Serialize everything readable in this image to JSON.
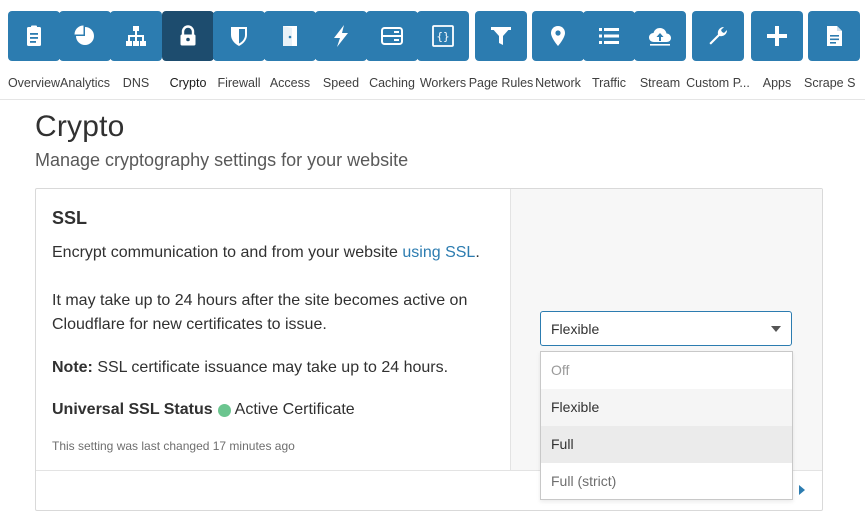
{
  "nav": {
    "items": [
      {
        "label": "Overview",
        "icon": "clipboard-icon"
      },
      {
        "label": "Analytics",
        "icon": "pie-chart-icon"
      },
      {
        "label": "DNS",
        "icon": "network-tree-icon"
      },
      {
        "label": "Crypto",
        "icon": "lock-icon",
        "active": true
      },
      {
        "label": "Firewall",
        "icon": "shield-icon"
      },
      {
        "label": "Access",
        "icon": "door-icon"
      },
      {
        "label": "Speed",
        "icon": "lightning-icon"
      },
      {
        "label": "Caching",
        "icon": "server-icon"
      },
      {
        "label": "Workers",
        "icon": "code-braces-icon"
      },
      {
        "label": "Page Rules",
        "icon": "filter-icon"
      },
      {
        "label": "Network",
        "icon": "location-pin-icon"
      },
      {
        "label": "Traffic",
        "icon": "list-icon"
      },
      {
        "label": "Stream",
        "icon": "cloud-upload-icon"
      },
      {
        "label": "Custom P...",
        "icon": "wrench-icon"
      },
      {
        "label": "Apps",
        "icon": "plus-icon"
      },
      {
        "label": "Scrape S",
        "icon": "document-icon"
      }
    ],
    "accent_color": "#2c7cb0",
    "active_color": "#1d4c6e"
  },
  "page": {
    "title": "Crypto",
    "subtitle": "Manage cryptography settings for your website"
  },
  "ssl_card": {
    "title": "SSL",
    "desc_prefix": "Encrypt communication to and from your website ",
    "desc_link": "using SSL",
    "desc_suffix": ".",
    "activation_note": "It may take up to 24 hours after the site becomes active on Cloudflare for new certificates to issue.",
    "note_label": "Note:",
    "note_text": " SSL certificate issuance may take up to 24 hours.",
    "status_label": "Universal SSL Status",
    "status_value": "Active Certificate",
    "status_color": "#6bc58f",
    "last_changed": "This setting was last changed 17 minutes ago"
  },
  "ssl_select": {
    "value": "Flexible",
    "options": [
      "Off",
      "Flexible",
      "Full",
      "Full (strict)"
    ]
  }
}
